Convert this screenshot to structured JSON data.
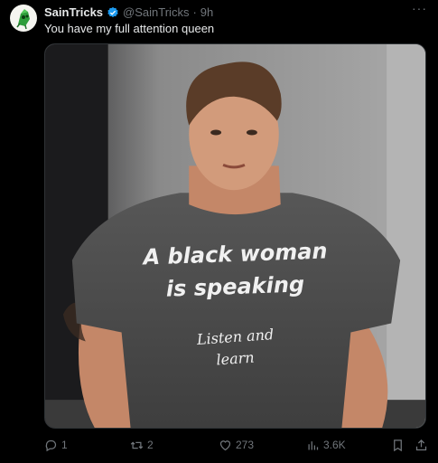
{
  "author": {
    "display_name": "SainTricks",
    "handle": "@SainTricks",
    "separator": "·",
    "time": "9h",
    "verified": true,
    "avatar_icon": "green-mascot-avatar"
  },
  "tweet": {
    "text": "You have my full attention queen"
  },
  "media": {
    "shirt_line1": "A black woman",
    "shirt_line2": "is speaking",
    "shirt_line3": "Listen and",
    "shirt_line4": "learn"
  },
  "actions": {
    "reply_count": "1",
    "retweet_count": "2",
    "like_count": "273",
    "views_count": "3.6K"
  },
  "more_label": "···",
  "colors": {
    "background": "#000000",
    "text_primary": "#e7e9ea",
    "text_secondary": "#71767b",
    "verified_blue": "#1d9bf0"
  }
}
